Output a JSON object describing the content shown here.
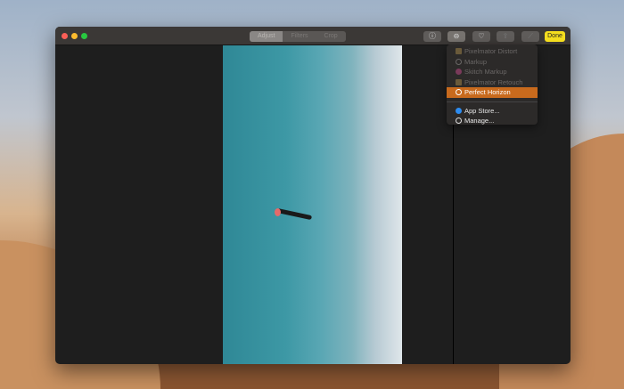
{
  "toolbar": {
    "tabs": [
      {
        "label": "Adjust"
      },
      {
        "label": "Filters"
      },
      {
        "label": "Crop"
      }
    ],
    "done_label": "Done"
  },
  "extensions_menu": {
    "items": [
      {
        "label": "Pixelmator Distort",
        "enabled": false
      },
      {
        "label": "Markup",
        "enabled": false
      },
      {
        "label": "Skitch Markup",
        "enabled": false
      },
      {
        "label": "Pixelmator Retouch",
        "enabled": false
      },
      {
        "label": "Perfect Horizon",
        "enabled": true,
        "selected": true
      }
    ],
    "footer": [
      {
        "label": "App Store..."
      },
      {
        "label": "Manage..."
      }
    ]
  },
  "colors": {
    "accent": "#c86a1d",
    "done": "#f4dd1e"
  }
}
